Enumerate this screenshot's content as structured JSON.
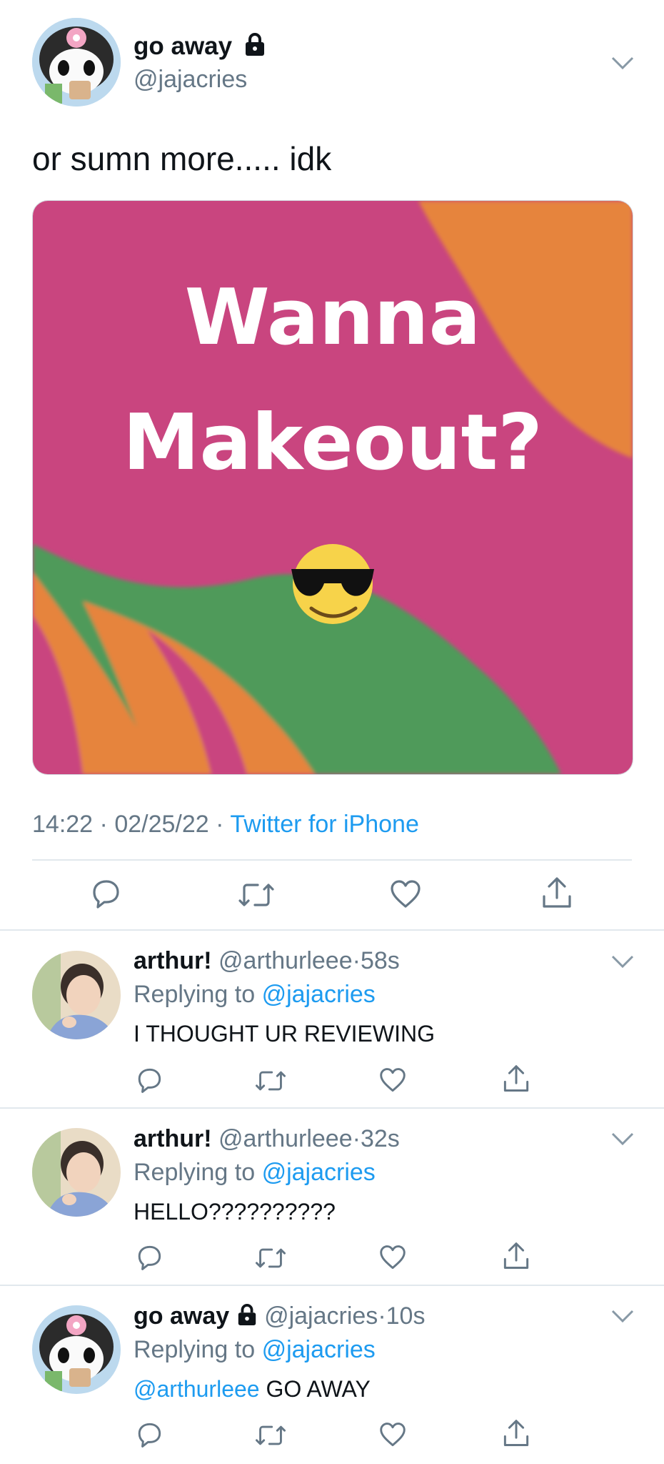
{
  "main_tweet": {
    "display_name": "go away",
    "handle": "@jajacries",
    "text": "or sumn more..... idk",
    "image_text_line1": "Wanna",
    "image_text_line2": "Makeout?",
    "time": "14:22",
    "date": "02/25/22",
    "source": "Twitter for iPhone",
    "sep": "·"
  },
  "replies": [
    {
      "display_name": "arthur!",
      "handle": "@arthurleee",
      "age": "58s",
      "replying_label": "Replying to",
      "replying_handle": "@jajacries",
      "text": "I THOUGHT UR REVIEWING"
    },
    {
      "display_name": "arthur!",
      "handle": "@arthurleee",
      "age": "32s",
      "replying_label": "Replying to",
      "replying_handle": "@jajacries",
      "text": "HELLO??????????"
    },
    {
      "display_name": "go away",
      "handle": "@jajacries",
      "age": "10s",
      "replying_label": "Replying to",
      "replying_handle": "@jajacries",
      "mention": "@arthurleee",
      "text": "GO AWAY"
    }
  ],
  "icons": {
    "lock": "lock-icon",
    "chevron": "chevron-down-icon",
    "reply": "reply-icon",
    "retweet": "retweet-icon",
    "like": "heart-icon",
    "share": "share-icon"
  },
  "colors": {
    "accent": "#1d9bf0",
    "secondary_text": "#657786",
    "divider": "#e1e8ed",
    "image_pink": "#c9457f",
    "image_orange": "#e6843c",
    "image_green": "#4f9a5a"
  }
}
